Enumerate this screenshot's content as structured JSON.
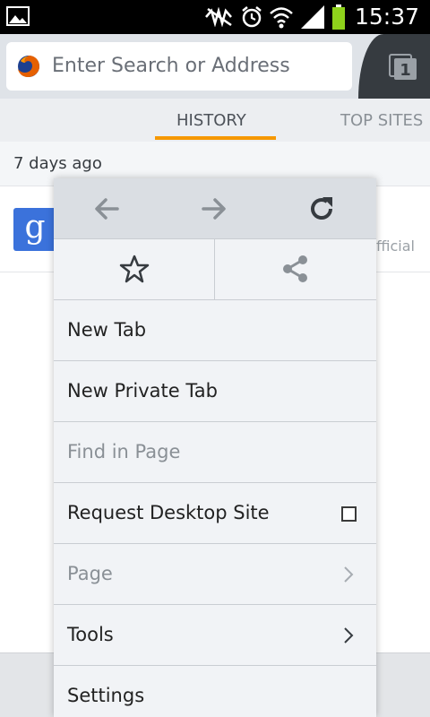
{
  "status_bar": {
    "time": "15:37",
    "icons": [
      "gallery-icon",
      "mute-icon",
      "alarm-icon",
      "wifi-icon",
      "signal-icon",
      "battery-icon"
    ]
  },
  "url_bar": {
    "placeholder": "Enter Search or Address",
    "tabs_count": "1"
  },
  "panel_tabs": [
    {
      "label": "HISTORY",
      "selected": true
    },
    {
      "label": "TOP SITES",
      "selected": false
    }
  ],
  "history": {
    "section_header": "7 days ago",
    "rows": [
      {
        "favicon": "g",
        "url_fragment": "fficial"
      }
    ]
  },
  "menu": {
    "nav": [
      "back-icon",
      "forward-icon",
      "reload-icon"
    ],
    "actions": [
      "bookmark-star-icon",
      "share-icon"
    ],
    "items": [
      {
        "label": "New Tab",
        "enabled": true
      },
      {
        "label": "New Private Tab",
        "enabled": true
      },
      {
        "label": "Find in Page",
        "enabled": false
      },
      {
        "label": "Request Desktop Site",
        "enabled": true,
        "checkbox": false
      },
      {
        "label": "Page",
        "enabled": false,
        "submenu": true
      },
      {
        "label": "Tools",
        "enabled": true,
        "submenu": true
      },
      {
        "label": "Settings",
        "enabled": true
      }
    ]
  },
  "colors": {
    "accent_orange": "#f69800",
    "google_blue": "#3b72db",
    "menu_bg": "#f1f3f6",
    "menu_nav_bg": "#dadee3",
    "url_bar_bg": "#dfe3e8",
    "tabs_button_bg": "#363b40"
  }
}
